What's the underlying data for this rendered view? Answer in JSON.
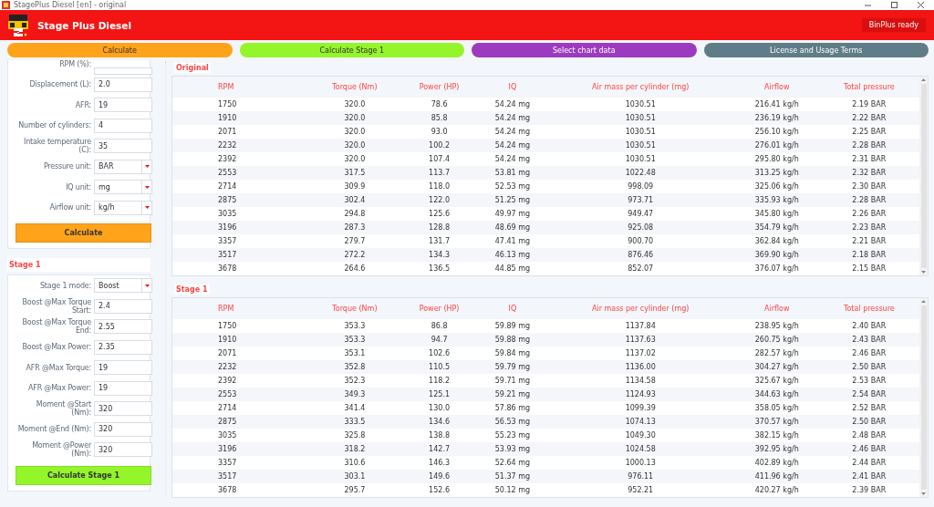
{
  "window": {
    "title": "StagePlus Diesel [en] - original"
  },
  "header": {
    "title": "Stage Plus Diesel",
    "status": "BinPlus ready"
  },
  "actions": [
    {
      "label": "Calculate",
      "color": "#ffa31a"
    },
    {
      "label": "Calculate Stage 1",
      "color": "#94f52a"
    },
    {
      "label": "Select chart data",
      "color": "#9c3bbf"
    },
    {
      "label": "License and Usage Terms",
      "color": "#5f7d88"
    }
  ],
  "engine": {
    "fields": [
      {
        "kind": "text",
        "label": "RPM (%):"
      },
      {
        "kind": "text",
        "label": "Displacement (L):",
        "value": "2.0"
      },
      {
        "kind": "text",
        "label": "AFR:",
        "value": "19"
      },
      {
        "kind": "text",
        "label": "Number of cylinders:",
        "value": "4"
      },
      {
        "kind": "text",
        "label": "Intake temperature (C):",
        "value": "35"
      },
      {
        "kind": "select",
        "label": "Pressure unit:",
        "value": "BAR"
      },
      {
        "kind": "select",
        "label": "IQ unit:",
        "value": "mg"
      },
      {
        "kind": "select",
        "label": "Airflow unit:",
        "value": "kg/h"
      }
    ],
    "button": "Calculate"
  },
  "stage1": {
    "title": "Stage 1",
    "fields": [
      {
        "kind": "select",
        "label": "Stage 1 mode:",
        "value": "Boost"
      },
      {
        "kind": "text",
        "label": "Boost @Max Torque Start:",
        "value": "2.4"
      },
      {
        "kind": "text",
        "label": "Boost @Max Torque End:",
        "value": "2.55"
      },
      {
        "kind": "text",
        "label": "Boost @Max Power:",
        "value": "2.35"
      },
      {
        "kind": "text",
        "label": "AFR @Max Torque:",
        "value": "19"
      },
      {
        "kind": "text",
        "label": "AFR @Max Power:",
        "value": "19"
      },
      {
        "kind": "text",
        "label": "Moment @Start (Nm):",
        "value": "320"
      },
      {
        "kind": "text",
        "label": "Moment @End (Nm):",
        "value": "320"
      },
      {
        "kind": "text",
        "label": "Moment @Power (Nm):",
        "value": "320"
      }
    ],
    "button": "Calculate Stage 1"
  },
  "tables": [
    {
      "title": "Original",
      "columns": [
        "RPM",
        "Torque (Nm)",
        "Power (HP)",
        "IQ",
        "Air mass per cylinder (mg)",
        "Airflow",
        "Total pressure"
      ],
      "rows": [
        [
          "1750",
          "320.0",
          "78.6",
          "54.24 mg",
          "1030.51",
          "216.41 kg/h",
          "2.19 BAR"
        ],
        [
          "1910",
          "320.0",
          "85.8",
          "54.24 mg",
          "1030.51",
          "236.19 kg/h",
          "2.22 BAR"
        ],
        [
          "2071",
          "320.0",
          "93.0",
          "54.24 mg",
          "1030.51",
          "256.10 kg/h",
          "2.25 BAR"
        ],
        [
          "2232",
          "320.0",
          "100.2",
          "54.24 mg",
          "1030.51",
          "276.01 kg/h",
          "2.28 BAR"
        ],
        [
          "2392",
          "320.0",
          "107.4",
          "54.24 mg",
          "1030.51",
          "295.80 kg/h",
          "2.31 BAR"
        ],
        [
          "2553",
          "317.5",
          "113.7",
          "53.81 mg",
          "1022.48",
          "313.25 kg/h",
          "2.32 BAR"
        ],
        [
          "2714",
          "309.9",
          "118.0",
          "52.53 mg",
          "998.09",
          "325.06 kg/h",
          "2.30 BAR"
        ],
        [
          "2875",
          "302.4",
          "122.0",
          "51.25 mg",
          "973.71",
          "335.93 kg/h",
          "2.28 BAR"
        ],
        [
          "3035",
          "294.8",
          "125.6",
          "49.97 mg",
          "949.47",
          "345.80 kg/h",
          "2.26 BAR"
        ],
        [
          "3196",
          "287.3",
          "128.8",
          "48.69 mg",
          "925.08",
          "354.79 kg/h",
          "2.23 BAR"
        ],
        [
          "3357",
          "279.7",
          "131.7",
          "47.41 mg",
          "900.70",
          "362.84 kg/h",
          "2.21 BAR"
        ],
        [
          "3517",
          "272.2",
          "134.3",
          "46.13 mg",
          "876.46",
          "369.90 kg/h",
          "2.18 BAR"
        ],
        [
          "3678",
          "264.6",
          "136.5",
          "44.85 mg",
          "852.07",
          "376.07 kg/h",
          "2.15 BAR"
        ]
      ]
    },
    {
      "title": "Stage 1",
      "columns": [
        "RPM",
        "Torque (Nm)",
        "Power (HP)",
        "IQ",
        "Air mass per cylinder (mg)",
        "Airflow",
        "Total pressure"
      ],
      "rows": [
        [
          "1750",
          "353.3",
          "86.8",
          "59.89 mg",
          "1137.84",
          "238.95 kg/h",
          "2.40 BAR"
        ],
        [
          "1910",
          "353.3",
          "94.7",
          "59.88 mg",
          "1137.63",
          "260.75 kg/h",
          "2.43 BAR"
        ],
        [
          "2071",
          "353.1",
          "102.6",
          "59.84 mg",
          "1137.02",
          "282.57 kg/h",
          "2.46 BAR"
        ],
        [
          "2232",
          "352.8",
          "110.5",
          "59.79 mg",
          "1136.00",
          "304.27 kg/h",
          "2.50 BAR"
        ],
        [
          "2392",
          "352.3",
          "118.2",
          "59.71 mg",
          "1134.58",
          "325.67 kg/h",
          "2.53 BAR"
        ],
        [
          "2553",
          "349.3",
          "125.1",
          "59.21 mg",
          "1124.93",
          "344.63 kg/h",
          "2.54 BAR"
        ],
        [
          "2714",
          "341.4",
          "130.0",
          "57.86 mg",
          "1099.39",
          "358.05 kg/h",
          "2.52 BAR"
        ],
        [
          "2875",
          "333.5",
          "134.6",
          "56.53 mg",
          "1074.13",
          "370.57 kg/h",
          "2.50 BAR"
        ],
        [
          "3035",
          "325.8",
          "138.8",
          "55.23 mg",
          "1049.30",
          "382.15 kg/h",
          "2.48 BAR"
        ],
        [
          "3196",
          "318.2",
          "142.7",
          "53.93 mg",
          "1024.58",
          "392.95 kg/h",
          "2.46 BAR"
        ],
        [
          "3357",
          "310.6",
          "146.3",
          "52.64 mg",
          "1000.13",
          "402.89 kg/h",
          "2.44 BAR"
        ],
        [
          "3517",
          "303.1",
          "149.6",
          "51.37 mg",
          "976.11",
          "411.96 kg/h",
          "2.41 BAR"
        ],
        [
          "3678",
          "295.7",
          "152.6",
          "50.12 mg",
          "952.21",
          "420.27 kg/h",
          "2.39 BAR"
        ]
      ]
    }
  ]
}
